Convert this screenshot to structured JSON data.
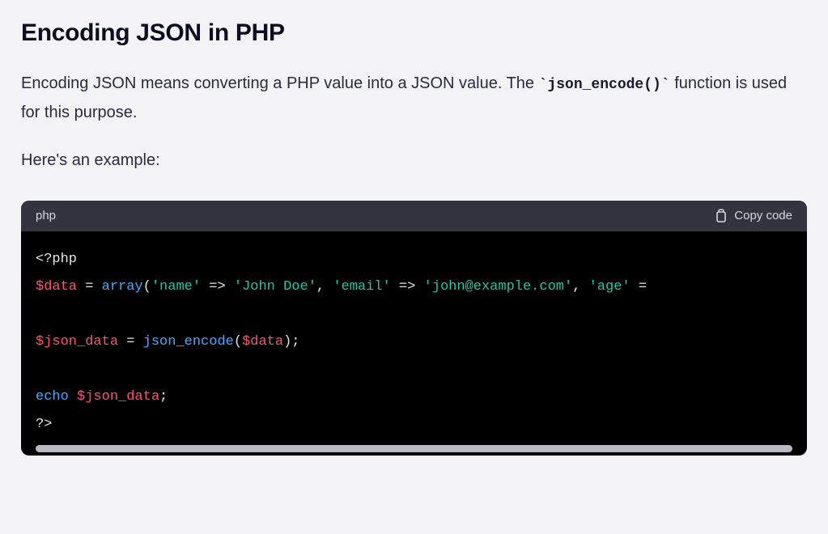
{
  "heading": "Encoding JSON in PHP",
  "para1_prefix": "Encoding JSON means converting a PHP value into a JSON value. The ",
  "para1_code": "`json_encode()`",
  "para1_suffix": " function is used for this purpose.",
  "para2": "Here's an example:",
  "code": {
    "language": "php",
    "copy_label": "Copy code",
    "tokens": {
      "open_tag": "<?php",
      "data_var": "$data",
      "eq": " = ",
      "array_kw": "array",
      "lp": "(",
      "s_name": "'name'",
      "fat": " => ",
      "s_john": "'John Doe'",
      "comma_sp": ", ",
      "s_email": "'email'",
      "s_emailv": "'john@example.com'",
      "s_age": "'age'",
      "eq2": " =",
      "json_var": "$json_data",
      "json_enc": "json_encode",
      "rp_semi": ");",
      "echo_kw": "echo ",
      "semi": ";",
      "close_tag": "?>"
    }
  }
}
